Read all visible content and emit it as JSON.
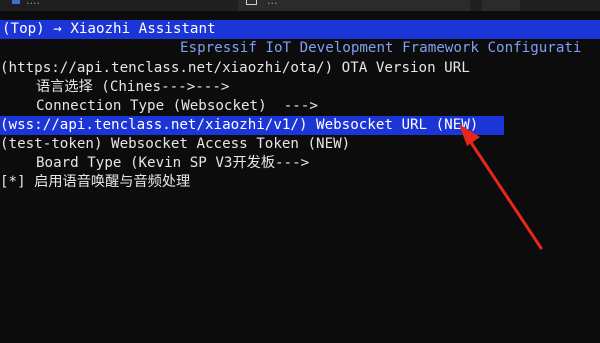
{
  "tabs": [
    {
      "label": "...."
    },
    {
      "label": "..."
    },
    {
      "label": ""
    }
  ],
  "menu": {
    "title": "(Top) → Xiaozhi Assistant",
    "subtitle": "Espressif IoT Development Framework Configurati",
    "items": [
      {
        "text": "(https://api.tenclass.net/xiaozhi/ota/) OTA Version URL",
        "indent": false,
        "selected": false
      },
      {
        "text": "语言选择 (Chines--->--->",
        "indent": true,
        "selected": false
      },
      {
        "text": "Connection Type (Websocket)  --->",
        "indent": true,
        "selected": false
      },
      {
        "text": "(wss://api.tenclass.net/xiaozhi/v1/) Websocket URL (NEW)",
        "indent": false,
        "selected": true
      },
      {
        "text": "(test-token) Websocket Access Token (NEW)",
        "indent": false,
        "selected": false
      },
      {
        "text": "Board Type (Kevin SP V3开发板--->",
        "indent": true,
        "selected": false
      },
      {
        "text": "[*] 启用语音唤醒与音频处理",
        "indent": false,
        "selected": false
      }
    ]
  },
  "annotation": {
    "color": "#e8261c",
    "icon": "red-arrow-annotation"
  }
}
